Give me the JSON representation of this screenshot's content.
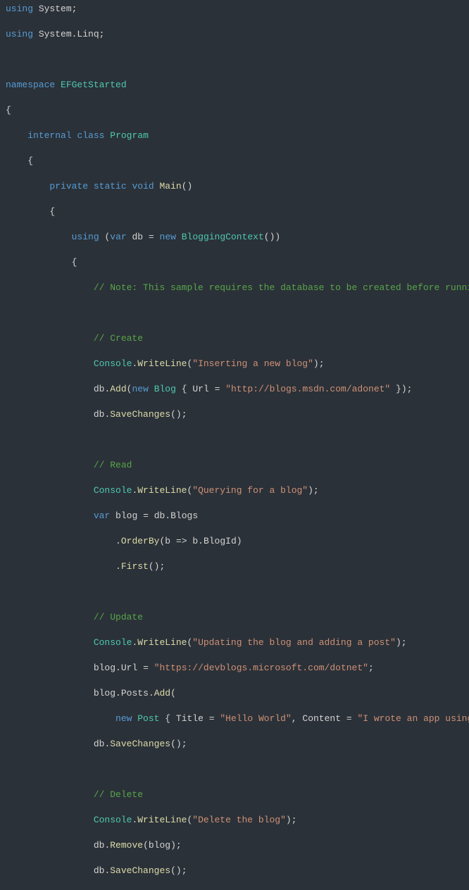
{
  "code": {
    "using1_kw": "using",
    "using1_ns": "System",
    "using2_kw": "using",
    "using2_ns": "System.Linq",
    "semi": ";",
    "ns_kw": "namespace",
    "ns_name": "EFGetStarted",
    "lbrace": "{",
    "rbrace": "}",
    "internal_kw": "internal",
    "class_kw": "class",
    "class_name": "Program",
    "private_kw": "private",
    "static_kw": "static",
    "void_kw": "void",
    "main_name": "Main",
    "paren_open": "(",
    "paren_close": ")",
    "using_stmt_kw": "using",
    "var_kw": "var",
    "db_name": "db",
    "eq": "=",
    "new_kw": "new",
    "blogctx": "BloggingContext",
    "parens_empty": "()",
    "cm_note": "// Note: This sample requires the database to be created before runni",
    "cm_create": "// Create",
    "console": "Console",
    "dot": ".",
    "writeline": "WriteLine",
    "str_insert": "\"Inserting a new blog\"",
    "db": "db",
    "add": "Add",
    "blog_type": "Blog",
    "url_prop": "Url",
    "str_url1": "\"http://blogs.msdn.com/adonet\"",
    "obj_close": "}",
    "savechanges": "SaveChanges",
    "cm_read": "// Read",
    "str_query": "\"Querying for a blog\"",
    "blog_var": "blog",
    "blogs_prop": "Blogs",
    "orderby": "OrderBy",
    "lambda_b": "b",
    "arrow": "=>",
    "blogid": "BlogId",
    "first": "First",
    "cm_update": "// Update",
    "str_update": "\"Updating the blog and adding a post\"",
    "str_url2": "\"https://devblogs.microsoft.com/dotnet\"",
    "posts_prop": "Posts",
    "post_type": "Post",
    "title_prop": "Title",
    "str_hello": "\"Hello World\"",
    "comma": ",",
    "content_prop": "Content",
    "str_content": "\"I wrote an app using",
    "cm_delete": "// Delete",
    "str_delete": "\"Delete the blog\"",
    "remove": "Remove"
  }
}
